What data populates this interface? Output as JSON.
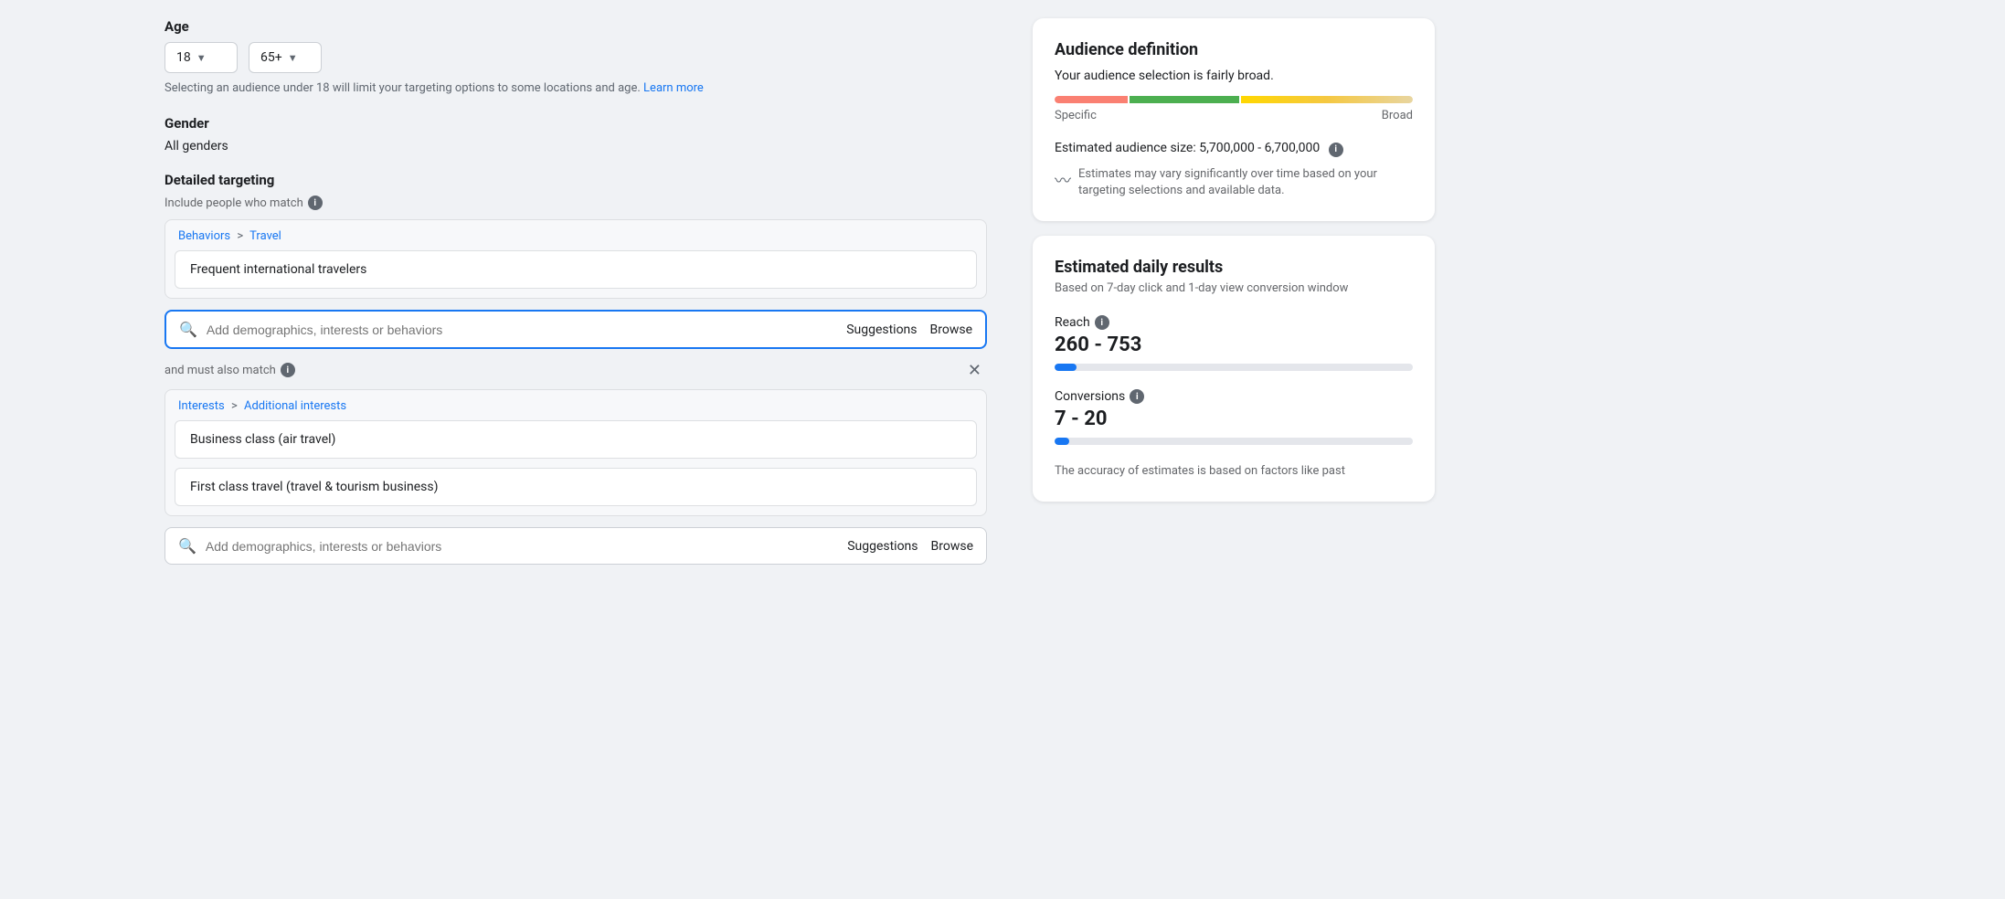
{
  "age": {
    "label": "Age",
    "min": "18",
    "max": "65+",
    "info_text": "Selecting an audience under 18 will limit your targeting options to some locations and age.",
    "learn_more": "Learn more"
  },
  "gender": {
    "label": "Gender",
    "value": "All genders"
  },
  "detailed_targeting": {
    "label": "Detailed targeting",
    "include_match_label": "Include people who match",
    "group1": {
      "breadcrumb_part1": "Behaviors",
      "breadcrumb_separator": ">",
      "breadcrumb_part2": "Travel",
      "item": "Frequent international travelers"
    },
    "search1": {
      "placeholder": "Add demographics, interests or behaviors",
      "suggestions_label": "Suggestions",
      "browse_label": "Browse"
    },
    "must_match_label": "and must also match",
    "group2": {
      "breadcrumb_part1": "Interests",
      "breadcrumb_separator": ">",
      "breadcrumb_part2": "Additional interests",
      "item1": "Business class (air travel)",
      "item2": "First class travel (travel & tourism business)"
    },
    "search2": {
      "placeholder": "Add demographics, interests or behaviors",
      "suggestions_label": "Suggestions",
      "browse_label": "Browse"
    }
  },
  "audience_definition": {
    "title": "Audience definition",
    "broad_text": "Your audience selection is fairly broad.",
    "specific_label": "Specific",
    "broad_label": "Broad",
    "size_label": "Estimated audience size:",
    "size_value": "5,700,000 - 6,700,000",
    "estimates_text": "Estimates may vary significantly over time based on your targeting selections and available data."
  },
  "daily_results": {
    "title": "Estimated daily results",
    "subtitle": "Based on 7-day click and 1-day view conversion window",
    "reach_label": "Reach",
    "reach_value": "260 - 753",
    "reach_fill_pct": "6",
    "conversions_label": "Conversions",
    "conversions_value": "7 - 20",
    "conversions_fill_pct": "4",
    "accuracy_text": "The accuracy of estimates is based on factors like past"
  }
}
